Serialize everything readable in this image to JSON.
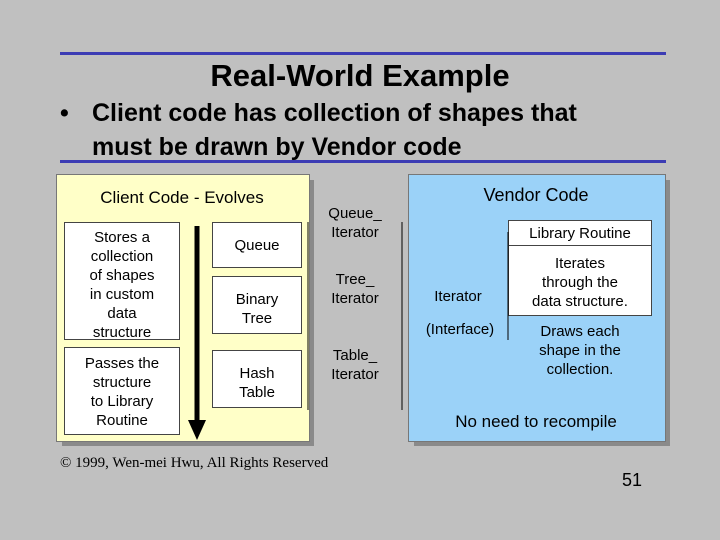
{
  "slide": {
    "title": "Real-World Example",
    "bullet_symbol": "•",
    "bullet_line1": "Client code has collection of shapes that",
    "bullet_line2": "must be drawn by Vendor code",
    "footer": "© 1999, Wen-mei Hwu, All Rights Reserved",
    "page_number": "51"
  },
  "client": {
    "header": "Client Code - Evolves",
    "stores_lines": [
      "Stores a",
      "collection",
      "of shapes",
      "in custom",
      "data",
      "structure"
    ],
    "passes_lines": [
      "Passes the",
      "structure",
      "to Library",
      "Routine"
    ],
    "structures": [
      {
        "lines": [
          "Queue"
        ]
      },
      {
        "lines": [
          "Binary",
          "Tree"
        ]
      },
      {
        "lines": [
          "Hash",
          "Table"
        ]
      }
    ]
  },
  "iterators": [
    {
      "lines": [
        "Queue_",
        "Iterator"
      ]
    },
    {
      "lines": [
        "Tree_",
        "Iterator"
      ]
    },
    {
      "lines": [
        "Table_",
        "Iterator"
      ]
    }
  ],
  "vendor": {
    "header": "Vendor Code",
    "library_routine": "Library Routine",
    "iterator": "Iterator",
    "interface": "(Interface)",
    "iterates_lines": [
      "Iterates",
      "through the",
      "data structure."
    ],
    "draws_lines": [
      "Draws each",
      "shape in the",
      "collection."
    ],
    "no_recompile": "No need to recompile"
  }
}
